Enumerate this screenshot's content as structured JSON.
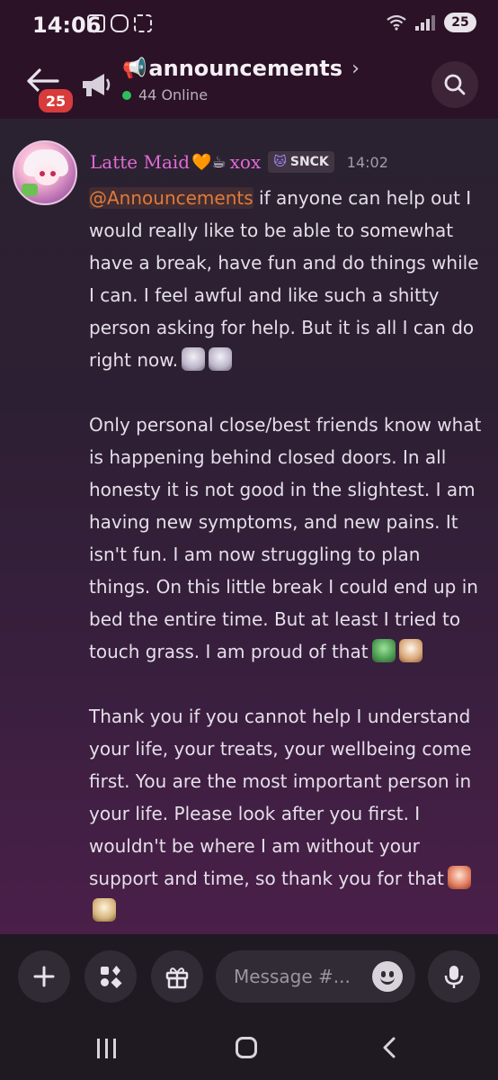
{
  "status_bar": {
    "time": "14:06",
    "battery_level": "25",
    "notification_icons": [
      "twitch-icon",
      "discord-icon",
      "screenshot-icon"
    ]
  },
  "header": {
    "unread_badge": "25",
    "channel_prefix": "📢",
    "channel_name": "announcements",
    "chevron": "›",
    "online_count_text": "44 Online"
  },
  "message": {
    "username": "Latte Maid",
    "username_emojis": "🧡☕",
    "username_suffix": "xox",
    "tag_icon": "🐱",
    "tag": "SNCK",
    "time": "14:02",
    "mention": "@Announcements",
    "p1_after_mention": " if anyone can help out I would really like to be able to somewhat have a break, have fun and do things while I can. I feel awful and like such a shitty person asking for help. But it is all I can do right now.",
    "p2": "Only personal close/best friends know what is happening behind closed doors. In all honesty it is not good in the slightest. I am having new symptoms, and new pains. It isn't fun. I am now struggling to plan things. On this little break I could end up in bed the entire time. But at least I tried to touch grass. I am proud of that",
    "p3": "Thank you if you cannot help I understand your life, your treats, your wellbeing come first. You are the most important person in your life. Please look after you first. I wouldn't be where I am without your support and time, so thank you for that"
  },
  "input_bar": {
    "placeholder": "Message #..."
  },
  "colors": {
    "header_bg": "#2b1226",
    "username": "#e36ad6",
    "mention": "#e07a3c",
    "online_dot": "#2fbf5a",
    "badge_red": "#d83b3b"
  }
}
